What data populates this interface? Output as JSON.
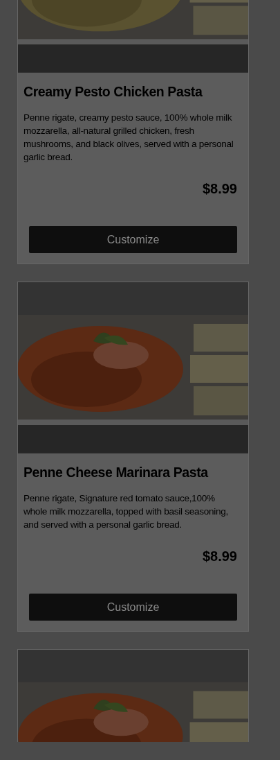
{
  "menu_items": [
    {
      "image": {
        "kind": "picture"
      },
      "title": "Creamy Pesto Chicken Pasta",
      "description": "Penne rigate, creamy pesto sauce, 100% whole milk mozzarella, all-natural grilled chicken, fresh mushrooms, and black olives, served with a personal garlic bread.",
      "price": "$8.99",
      "button": "Customize"
    },
    {
      "image": {
        "kind": "picture"
      },
      "title": "Penne Cheese Marinara Pasta",
      "description": "Penne rigate, Signature red tomato sauce,100% whole milk mozzarella, topped with basil seasoning, and served with a personal garlic bread.",
      "price": "$8.99",
      "button": "Customize"
    },
    {
      "image": {
        "kind": "picture"
      }
    }
  ]
}
